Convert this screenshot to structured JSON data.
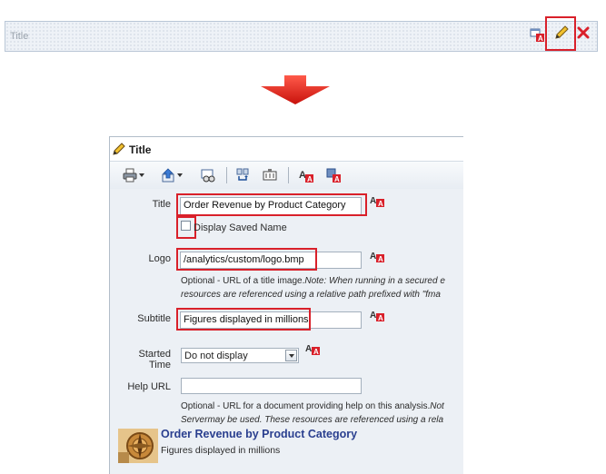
{
  "titlebar": {
    "label": "Title"
  },
  "dialog": {
    "title": "Title",
    "fields": {
      "title": {
        "label": "Title",
        "value": "Order Revenue by Product Category"
      },
      "display_saved_name": {
        "label": "Display Saved Name",
        "checked": false
      },
      "logo": {
        "label": "Logo",
        "value": "/analytics/custom/logo.bmp",
        "help_plain": "Optional - URL of a title image.",
        "help_italic_1": "Note: When running in a secured e",
        "help_italic_2": "resources are referenced using a relative path prefixed with \"fma"
      },
      "subtitle": {
        "label": "Subtitle",
        "value": "Figures displayed in millions"
      },
      "started_time": {
        "label": "Started Time",
        "value": "Do not display"
      },
      "help_url": {
        "label": "Help URL",
        "value": "",
        "help_plain": "Optional - URL for a document providing help on this analysis.",
        "help_italic_1": "Not",
        "help_italic_2": "Servermay be used. These resources are referenced using a rela"
      }
    },
    "preview": {
      "title": "Order Revenue by Product Category",
      "subtitle": "Figures displayed in millions"
    }
  },
  "colors": {
    "highlight": "#d9202a",
    "preview_title": "#2a3f8f",
    "panel_bg": "#ecf0f5"
  }
}
